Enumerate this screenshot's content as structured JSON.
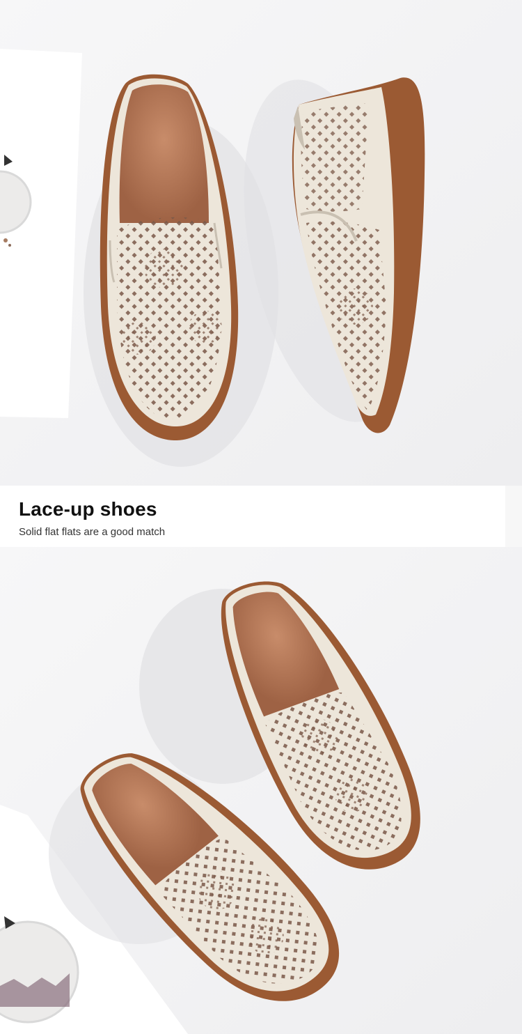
{
  "caption": {
    "title": "Lace-up shoes",
    "subtitle": "Solid flat flats are a good match"
  },
  "palette": {
    "background": "#f3f3f4",
    "leather": "#ede6da",
    "lining": "#b77d5e",
    "sole": "#9b5a33",
    "perforation": "#6b4a3a"
  },
  "photos": [
    {
      "name": "product-photo-top",
      "subject": "pair of perforated slip-on flats"
    },
    {
      "name": "product-photo-bottom",
      "subject": "pair of perforated slip-on flats"
    }
  ]
}
